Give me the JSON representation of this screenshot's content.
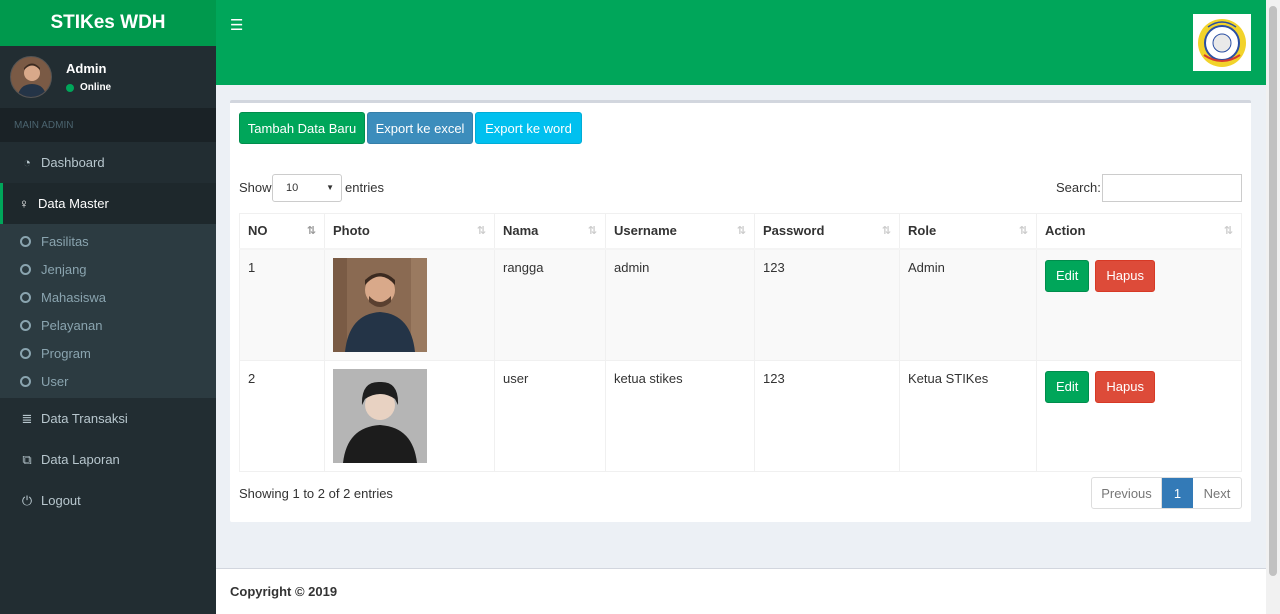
{
  "app": {
    "title": "STIKes WDH"
  },
  "user": {
    "name": "Admin",
    "status": "Online"
  },
  "sidebar": {
    "header": "MAIN ADMIN",
    "items": [
      {
        "label": "Dashboard",
        "icon": "dashboard-icon"
      },
      {
        "label": "Data Master",
        "icon": "user-icon",
        "active": true,
        "children": [
          "Fasilitas",
          "Jenjang",
          "Mahasiswa",
          "Pelayanan",
          "Program",
          "User"
        ]
      },
      {
        "label": "Data Transaksi",
        "icon": "database-icon"
      },
      {
        "label": "Data Laporan",
        "icon": "copy-icon"
      },
      {
        "label": "Logout",
        "icon": "power-icon"
      }
    ]
  },
  "toolbar": {
    "add": "Tambah Data Baru",
    "excel": "Export ke excel",
    "word": "Export ke word"
  },
  "datatable": {
    "show_label": "Show",
    "page_size": "10",
    "entries_label": "entries",
    "search_label": "Search:",
    "columns": [
      "NO",
      "Photo",
      "Nama",
      "Username",
      "Password",
      "Role",
      "Action"
    ],
    "rows": [
      {
        "no": "1",
        "nama": "rangga",
        "username": "admin",
        "password": "123",
        "role": "Admin"
      },
      {
        "no": "2",
        "nama": "user",
        "username": "ketua stikes",
        "password": "123",
        "role": "Ketua STIKes"
      }
    ],
    "edit_label": "Edit",
    "delete_label": "Hapus",
    "info": "Showing 1 to 2 of 2 entries",
    "pager": {
      "previous": "Previous",
      "current": "1",
      "next": "Next"
    }
  },
  "footer": {
    "copyright": "Copyright © 2019"
  },
  "colors": {
    "brand": "#00a65a",
    "sidebar": "#222d32",
    "danger": "#dd4b39",
    "info": "#00c0ef",
    "primary": "#3c8dbc"
  }
}
